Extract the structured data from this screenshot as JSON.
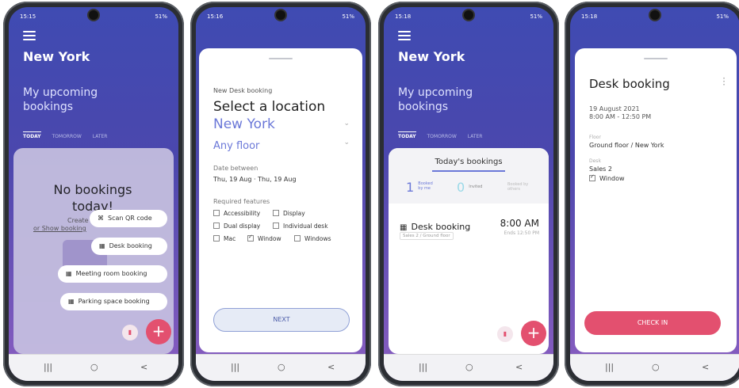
{
  "screen1": {
    "time": "15:15",
    "status_right": "51%",
    "city": "New York",
    "upcoming": "My upcoming bookings",
    "tabs": [
      "TODAY",
      "TOMORROW",
      "LATER"
    ],
    "no_bookings": "No bookings today!",
    "create_text": "Create",
    "or_show": "or Show booking",
    "menu_scan": "Scan QR code",
    "menu_desk": "Desk booking",
    "menu_meeting": "Meeting room booking",
    "menu_parking": "Parking space booking",
    "fab": "+"
  },
  "screen2": {
    "time": "15:16",
    "status_right": "51%",
    "subtitle": "New Desk booking",
    "title": "Select a location",
    "city": "New York",
    "floor": "Any floor",
    "date_label": "Date between",
    "date_value": "Thu, 19 Aug  ·  Thu, 19 Aug",
    "features_label": "Required features",
    "features": [
      {
        "label": "Accessibility",
        "checked": false
      },
      {
        "label": "Display",
        "checked": false
      },
      {
        "label": "Dual display",
        "checked": false
      },
      {
        "label": "Individual desk",
        "checked": false
      },
      {
        "label": "Mac",
        "checked": false
      },
      {
        "label": "Window",
        "checked": true
      },
      {
        "label": "Windows",
        "checked": false
      }
    ],
    "next": "NEXT"
  },
  "screen3": {
    "time": "15:18",
    "status_right": "51%",
    "city": "New York",
    "upcoming": "My upcoming bookings",
    "tabs": [
      "TODAY",
      "TOMORROW",
      "LATER"
    ],
    "card_title": "Today's bookings",
    "booked_me_count": "1",
    "booked_me_label": "Booked by me",
    "invited_count": "0",
    "invited_label": "Invited",
    "booked_others_label": "Booked by others",
    "booking_title": "Desk booking",
    "booking_time": "8:00 AM",
    "booking_location": "Sales 2 / Ground floor",
    "booking_ends": "Ends 12:50 PM",
    "fab": "+"
  },
  "screen4": {
    "time": "15:18",
    "status_right": "51%",
    "title": "Desk booking",
    "date": "19 August 2021",
    "time_range": "8:00 AM - 12:50 PM",
    "floor_label": "Floor",
    "floor_value": "Ground floor / New York",
    "desk_label": "Desk",
    "desk_value": "Sales 2",
    "feature": "Window",
    "checkin": "CHECK IN"
  },
  "nav": {
    "recent": "|||",
    "home": "○",
    "back": "<"
  },
  "colors": {
    "accent": "#e3506f",
    "primary": "#4b47ad",
    "link": "#6b78d8"
  }
}
